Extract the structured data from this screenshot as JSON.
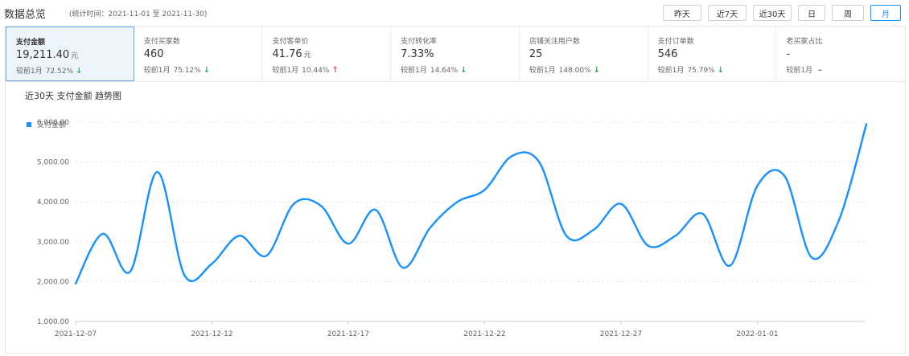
{
  "header": {
    "title": "数据总览",
    "period": "(统计时间：2021-11-01 至 2021-11-30)",
    "range_buttons": [
      {
        "label": "昨天",
        "active": false
      },
      {
        "label": "近7天",
        "active": false
      },
      {
        "label": "近30天",
        "active": false
      },
      {
        "label": "日",
        "active": false
      },
      {
        "label": "周",
        "active": false
      },
      {
        "label": "月",
        "active": true
      }
    ]
  },
  "kpis": [
    {
      "label": "支付金额",
      "value": "19,211.40",
      "unit": "元",
      "compare": "较前1月",
      "pct": "72.52%",
      "trend": "down",
      "active": true
    },
    {
      "label": "支付买家数",
      "value": "460",
      "unit": "",
      "compare": "较前1月",
      "pct": "75.12%",
      "trend": "down",
      "active": false
    },
    {
      "label": "支付客单价",
      "value": "41.76",
      "unit": "元",
      "compare": "较前1月",
      "pct": "10.44%",
      "trend": "up",
      "active": false
    },
    {
      "label": "支付转化率",
      "value": "7.33%",
      "unit": "",
      "compare": "较前1月",
      "pct": "14.64%",
      "trend": "down",
      "active": false
    },
    {
      "label": "店铺关注用户数",
      "value": "25",
      "unit": "",
      "compare": "较前1月",
      "pct": "148.00%",
      "trend": "down",
      "active": false
    },
    {
      "label": "支付订单数",
      "value": "546",
      "unit": "",
      "compare": "较前1月",
      "pct": "75.79%",
      "trend": "down",
      "active": false
    },
    {
      "label": "老买家占比",
      "value": "-",
      "unit": "",
      "compare": "较前1月",
      "pct": "",
      "trend": "none",
      "active": false
    }
  ],
  "colors": {
    "accent": "#1890ff",
    "down": "#2daa56",
    "up": "#ee4f4f"
  },
  "chart_data": {
    "type": "line",
    "title": "近30天 支付金额 趋势图",
    "legend": "支付金额",
    "legend_position": "top-left",
    "grid": true,
    "smooth": true,
    "y_ticks": [
      "1,000.00",
      "2,000.00",
      "3,000.00",
      "4,000.00",
      "5,000.00",
      "6,000.00"
    ],
    "ylim": [
      1000,
      6000
    ],
    "x_ticks": [
      "2021-12-07",
      "2021-12-12",
      "2021-12-17",
      "2021-12-22",
      "2021-12-27",
      "2022-01-01"
    ],
    "x": [
      "2021-12-07",
      "2021-12-08",
      "2021-12-09",
      "2021-12-10",
      "2021-12-11",
      "2021-12-12",
      "2021-12-13",
      "2021-12-14",
      "2021-12-15",
      "2021-12-16",
      "2021-12-17",
      "2021-12-18",
      "2021-12-19",
      "2021-12-20",
      "2021-12-21",
      "2021-12-22",
      "2021-12-23",
      "2021-12-24",
      "2021-12-25",
      "2021-12-26",
      "2021-12-27",
      "2021-12-28",
      "2021-12-29",
      "2021-12-30",
      "2021-12-31",
      "2022-01-01",
      "2022-01-02",
      "2022-01-03",
      "2022-01-04",
      "2022-01-05"
    ],
    "series": [
      {
        "name": "支付金额",
        "values": [
          1950,
          3200,
          2250,
          4750,
          2150,
          2450,
          3150,
          2650,
          3950,
          3900,
          2950,
          3800,
          2350,
          3350,
          4000,
          4300,
          5150,
          5000,
          3150,
          3300,
          3950,
          2900,
          3150,
          3700,
          2400,
          4400,
          4650,
          2600,
          3550,
          5950
        ]
      }
    ]
  }
}
